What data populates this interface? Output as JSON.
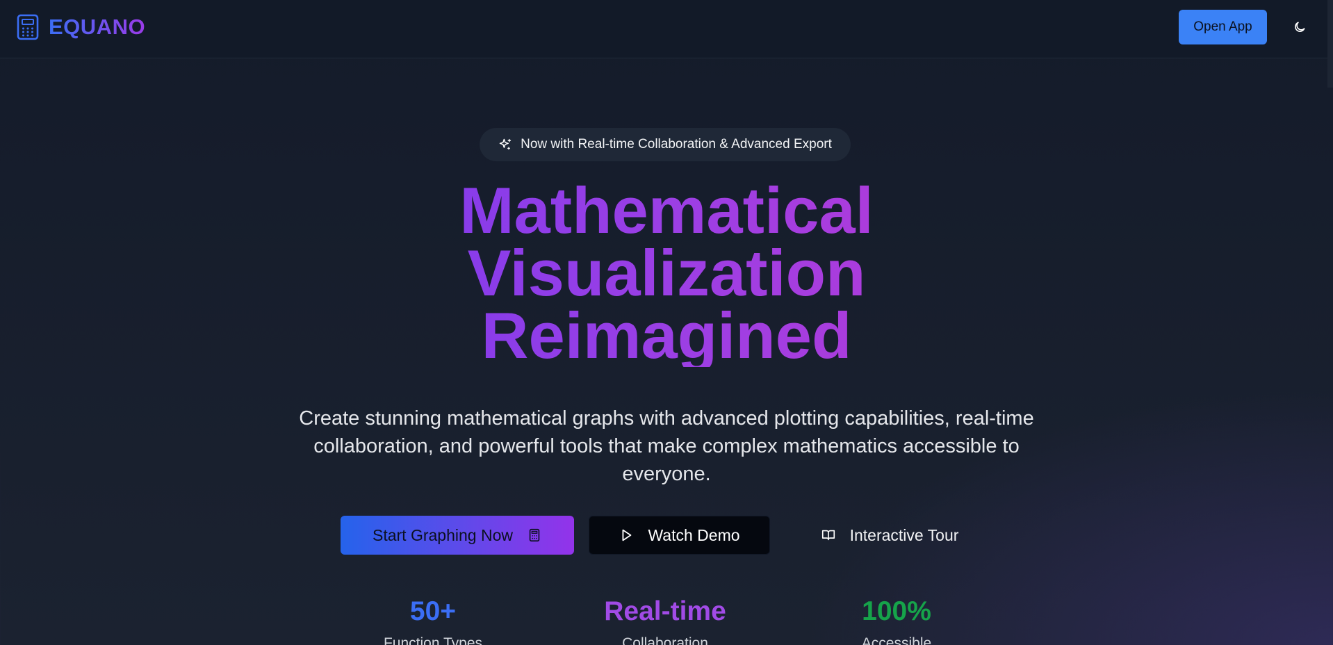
{
  "header": {
    "brand": "EQUANO",
    "brand_icon": "calculator-icon",
    "open_app_label": "Open App",
    "theme_icon": "moon-icon"
  },
  "badge": {
    "icon": "sparkles-icon",
    "text": "Now with Real-time Collaboration & Advanced Export"
  },
  "hero": {
    "title_lines": [
      "Mathematical",
      "Visualization",
      "Reimagined"
    ],
    "subtitle": "Create stunning mathematical graphs with advanced plotting capabilities, real-time collaboration, and powerful tools that make complex mathematics accessible to everyone."
  },
  "cta": {
    "primary_label": "Start Graphing Now",
    "primary_icon": "calculator-icon",
    "demo_label": "Watch Demo",
    "demo_icon": "play-icon",
    "tour_label": "Interactive Tour",
    "tour_icon": "book-open-icon"
  },
  "stats": [
    {
      "value": "50+",
      "label": "Function Types"
    },
    {
      "value": "Real-time",
      "label": "Collaboration"
    },
    {
      "value": "100%",
      "label": "Accessible"
    }
  ],
  "colors": {
    "accent_blue": "#3b82f6",
    "gradient_start": "#2563eb",
    "gradient_end": "#9333ea",
    "stat_green": "#16a34a"
  }
}
